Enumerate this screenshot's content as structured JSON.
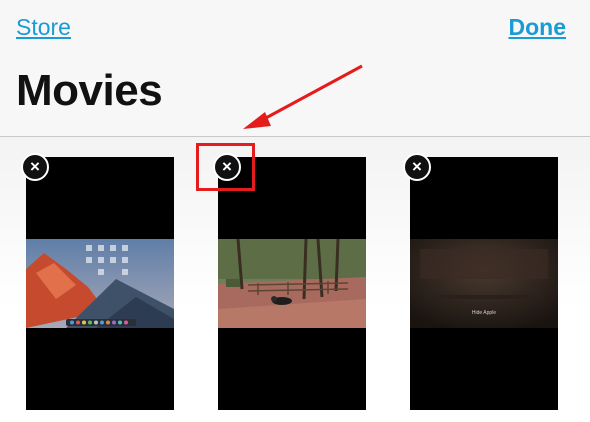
{
  "nav": {
    "left_link": "Store",
    "right_link": "Done"
  },
  "page": {
    "title": "Movies"
  },
  "icons": {
    "delete": "close-icon"
  },
  "movies": [
    {
      "delete_glyph": "×",
      "thumbnail": "desktop-wallpaper"
    },
    {
      "delete_glyph": "×",
      "thumbnail": "park-scene"
    },
    {
      "delete_glyph": "×",
      "thumbnail": "dark-stage",
      "caption": "Hide Apple"
    }
  ],
  "colors": {
    "link": "#1a9bd7",
    "annotation": "#e51c1c",
    "card": "#000000"
  }
}
